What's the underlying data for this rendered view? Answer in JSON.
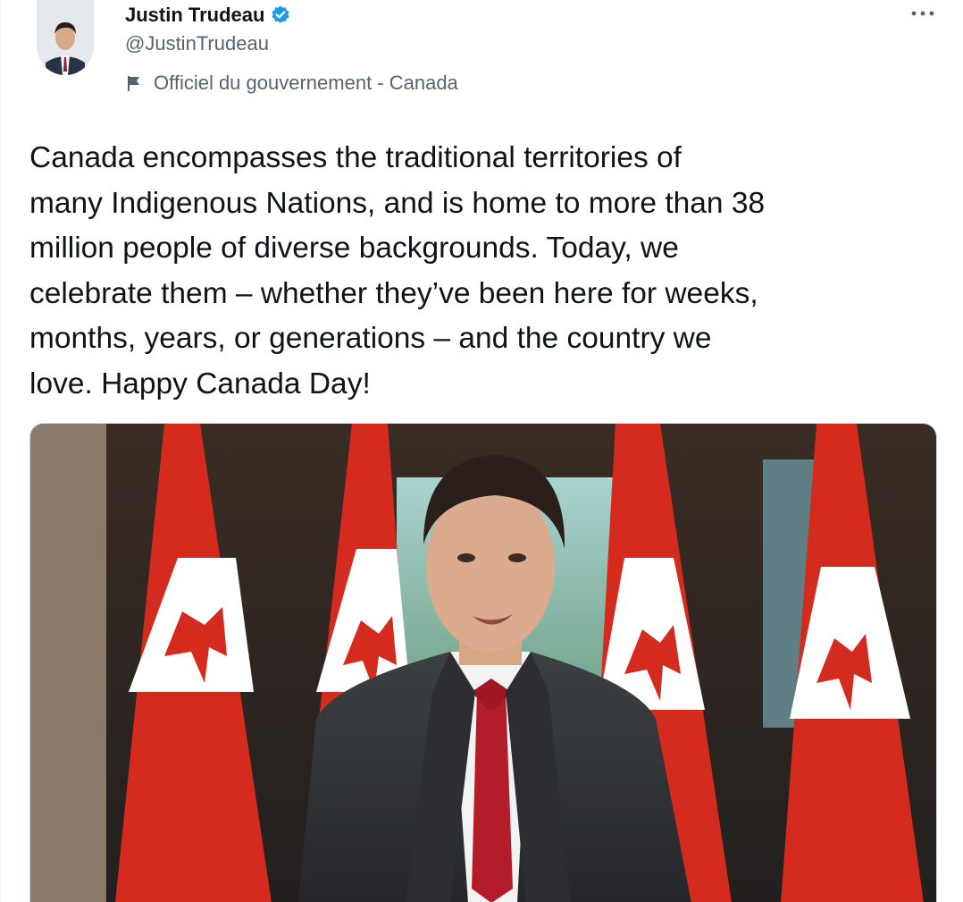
{
  "author": {
    "display_name": "Justin Trudeau",
    "handle": "@JustinTrudeau",
    "verified": true,
    "label": "Officiel du gouvernement - Canada"
  },
  "icons": {
    "verified": "verified-badge-icon",
    "label": "flag-icon",
    "more": "more-options-icon"
  },
  "tweet": {
    "text": "Canada encompasses the traditional territories of\nmany Indigenous Nations, and is home to more than 38\nmillion people of diverse backgrounds. Today, we\ncelebrate them – whether they’ve been here for weeks,\nmonths, years, or generations – and the country we\nlove. Happy Canada Day!"
  },
  "media": {
    "type": "video-thumbnail"
  },
  "colors": {
    "accent": "#1d9bf0",
    "text_primary": "#0f1419",
    "text_secondary": "#536471",
    "flag_red": "#d52b1e"
  }
}
